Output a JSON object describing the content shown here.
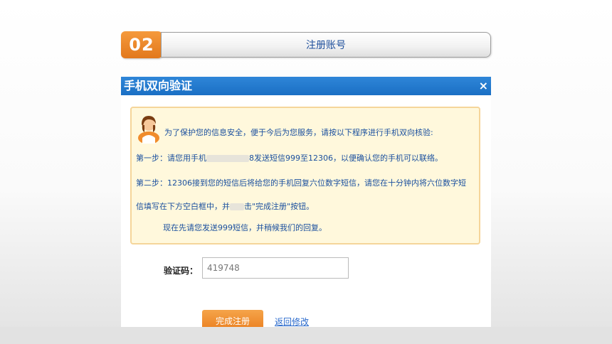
{
  "step": {
    "number": "02",
    "title": "注册账号"
  },
  "dialog": {
    "title": "手机双向验证",
    "close": "×",
    "notice": {
      "intro": "为了保护您的信息安全，便于今后为您服务，请按以下程序进行手机双向核验:",
      "step1_prefix": "第一步：请您用手机",
      "step1_suffix": "8发送短信999至12306，以便确认您的手机可以联络。",
      "step2_line1": "第二步：12306接到您的短信后将给您的手机回复六位数字短信，请您在十分钟内将六位数字短",
      "step2_line2_prefix": "信填写在下方空白框中，并",
      "step2_line2_suffix": "击\"完成注册\"按钮。",
      "now": "现在先请您发送999短信，并稍候我们的回复。"
    },
    "code_label": "验证码：",
    "code_value": "419748",
    "finish_button": "完成注册",
    "back_link": "返回修改"
  },
  "icons": {
    "avatar": "customer-service-avatar",
    "close": "close-icon"
  },
  "colors": {
    "title_bar": "#1f74c8",
    "notice_bg": "#fff8dc",
    "notice_border": "#f5d59a",
    "accent_orange": "#ea7e1e",
    "text_blue": "#1a4f9e"
  }
}
